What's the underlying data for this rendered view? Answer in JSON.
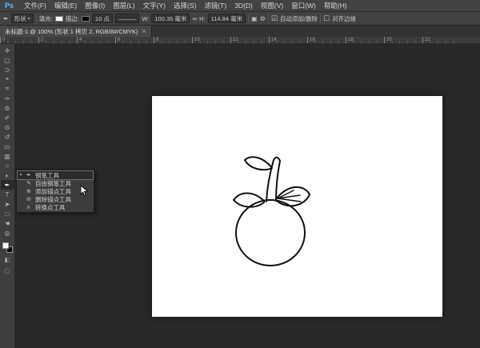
{
  "app": {
    "logo_text": "Ps"
  },
  "menu_bar": {
    "items": [
      "文件(F)",
      "编辑(E)",
      "图像(I)",
      "图层(L)",
      "文字(Y)",
      "选择(S)",
      "滤镜(T)",
      "3D(D)",
      "视图(V)",
      "窗口(W)",
      "帮助(H)"
    ]
  },
  "options_bar": {
    "tool_icon": "✒",
    "mode_value": "形状",
    "mode_caret": "▾",
    "fill_label": "填充:",
    "stroke_label": "描边:",
    "stroke_width_value": "10 点",
    "stroke_style_value": "———",
    "w_label": "W:",
    "w_value": "100.35 毫米",
    "link_icon": "∞",
    "h_label": "H:",
    "h_value": "114.84 毫米",
    "ops_icon": "▣",
    "gear_icon": "⚙",
    "auto_checkbox": "☑",
    "auto_label": "自动添加/删除",
    "align_checkbox": "☐",
    "align_label": "对齐边缘"
  },
  "tab_bar": {
    "title": "未标题-1 @ 100% (形状 1 拷贝 2, RGB/8#/CMYK)",
    "close_glyph": "×"
  },
  "ruler": {
    "labels": [
      "0",
      "2",
      "4",
      "6",
      "8",
      "10",
      "12",
      "14",
      "16",
      "18",
      "20",
      "22"
    ]
  },
  "toolbar": {
    "tools": [
      {
        "name": "move-tool",
        "glyph": "✛",
        "active": false
      },
      {
        "name": "rectangular-marquee-tool",
        "glyph": "▢",
        "active": false
      },
      {
        "name": "lasso-tool",
        "glyph": "⊃",
        "active": false
      },
      {
        "name": "quick-selection-tool",
        "glyph": "⌖",
        "active": false
      },
      {
        "name": "crop-tool",
        "glyph": "⌗",
        "active": false
      },
      {
        "name": "eyedropper-tool",
        "glyph": "✑",
        "active": false
      },
      {
        "name": "spot-healing-brush-tool",
        "glyph": "⊜",
        "active": false
      },
      {
        "name": "brush-tool",
        "glyph": "✐",
        "active": false
      },
      {
        "name": "clone-stamp-tool",
        "glyph": "⊙",
        "active": false
      },
      {
        "name": "history-brush-tool",
        "glyph": "↺",
        "active": false
      },
      {
        "name": "eraser-tool",
        "glyph": "▭",
        "active": false
      },
      {
        "name": "gradient-tool",
        "glyph": "▥",
        "active": false
      },
      {
        "name": "blur-tool",
        "glyph": "○",
        "active": false
      },
      {
        "name": "dodge-tool",
        "glyph": "◐",
        "active": false
      },
      {
        "name": "pen-tool",
        "glyph": "✒",
        "active": true
      },
      {
        "name": "horizontal-type-tool",
        "glyph": "T",
        "active": false
      },
      {
        "name": "path-selection-tool",
        "glyph": "➤",
        "active": false
      },
      {
        "name": "rectangle-tool",
        "glyph": "□",
        "active": false
      },
      {
        "name": "hand-tool",
        "glyph": "☚",
        "active": false
      },
      {
        "name": "zoom-tool",
        "glyph": "◎",
        "active": false
      }
    ]
  },
  "tool_flyout": {
    "items": [
      {
        "marker": "▪",
        "icon": "✒",
        "label": "钢笔工具",
        "active": true
      },
      {
        "marker": "",
        "icon": "✎",
        "label": "自由钢笔工具",
        "active": false
      },
      {
        "marker": "",
        "icon": "⊕",
        "label": "添加锚点工具",
        "active": false
      },
      {
        "marker": "",
        "icon": "⊖",
        "label": "删除锚点工具",
        "active": false
      },
      {
        "marker": "",
        "icon": "∧",
        "label": "转换点工具",
        "active": false
      }
    ]
  },
  "canvas": {
    "drawing": "tomato-line-art"
  },
  "colors": {
    "bar_bg": "#424242",
    "pasteboard": "#282828",
    "canvas": "#ffffff",
    "ps_logo": "#6fb6ff",
    "line_art": "#111111"
  }
}
